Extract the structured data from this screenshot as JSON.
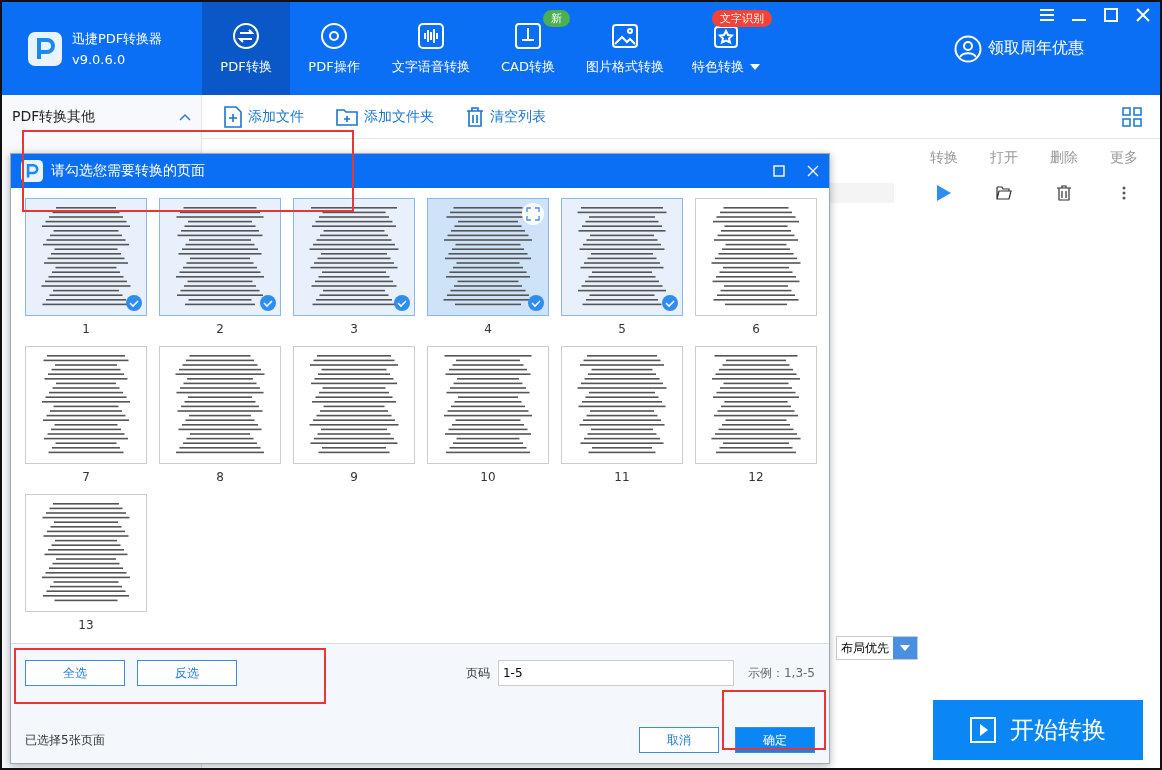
{
  "app": {
    "name": "迅捷PDF转换器",
    "version": "v9.0.6.0"
  },
  "nav": [
    {
      "label": "PDF转换",
      "selected": true
    },
    {
      "label": "PDF操作",
      "selected": false
    },
    {
      "label": "文字语音转换",
      "selected": false
    },
    {
      "label": "CAD转换",
      "selected": false,
      "badge": "新"
    },
    {
      "label": "图片格式转换",
      "selected": false
    },
    {
      "label": "特色转换",
      "selected": false,
      "badge": "文字识别",
      "dropdown": true
    }
  ],
  "promo": "领取周年优惠",
  "sidebar": {
    "title": "PDF转换其他",
    "expanded": true
  },
  "toolbar": [
    {
      "label": "添加文件"
    },
    {
      "label": "添加文件夹"
    },
    {
      "label": "清空列表"
    }
  ],
  "table": {
    "columns": [
      "转换",
      "打开",
      "删除",
      "更多"
    ]
  },
  "layout_select": {
    "value": "布局优先"
  },
  "start_button": "开始转换",
  "dialog": {
    "title": "请勾选您需要转换的页面",
    "pages": [
      {
        "label": "1",
        "selected": true
      },
      {
        "label": "2",
        "selected": true
      },
      {
        "label": "3",
        "selected": true
      },
      {
        "label": "4",
        "selected": true,
        "hovered": true
      },
      {
        "label": "5",
        "selected": true
      },
      {
        "label": "6",
        "selected": false
      },
      {
        "label": "7",
        "selected": false
      },
      {
        "label": "8",
        "selected": false
      },
      {
        "label": "9",
        "selected": false
      },
      {
        "label": "10",
        "selected": false
      },
      {
        "label": "11",
        "selected": false
      },
      {
        "label": "12",
        "selected": false
      },
      {
        "label": "13",
        "selected": false
      }
    ],
    "select_all": "全选",
    "invert": "反选",
    "page_label": "页码",
    "page_value": "1-5",
    "example": "示例：1,3-5",
    "status": "已选择5张页面",
    "cancel": "取消",
    "ok": "确定"
  }
}
